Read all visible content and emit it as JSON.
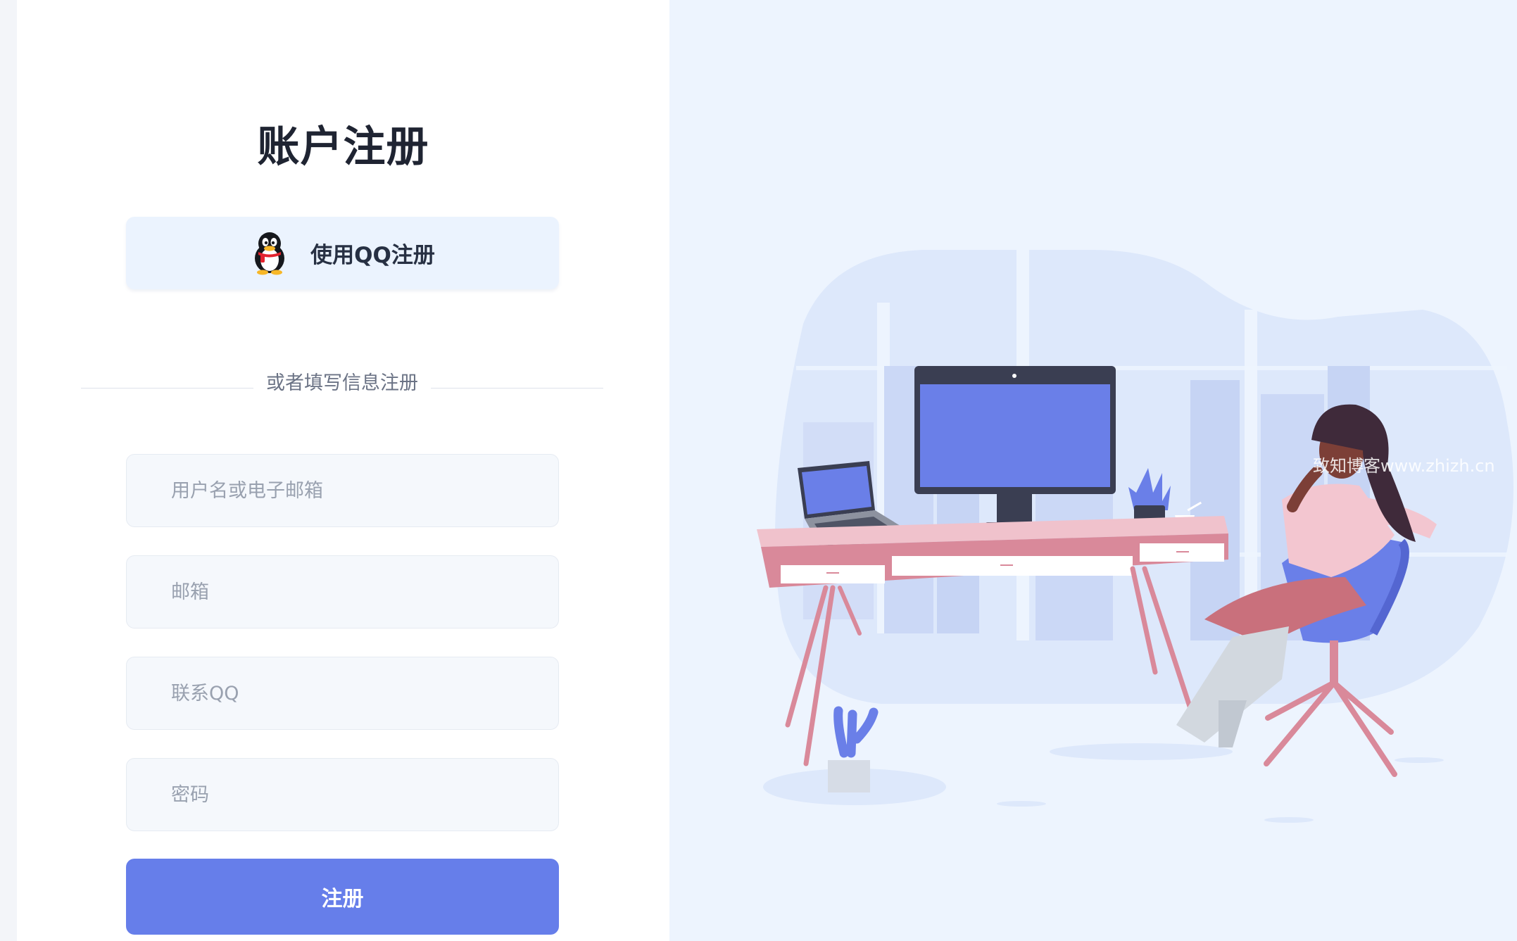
{
  "register": {
    "title": "账户注册",
    "qq_button_label": "使用QQ注册",
    "divider_text": "或者填写信息注册",
    "username_placeholder": "用户名或电子邮箱",
    "email_placeholder": "邮箱",
    "qq_placeholder": "联系QQ",
    "password_placeholder": "密码",
    "submit_label": "注册"
  },
  "illustration": {
    "watermark": "致知博客www.zhizh.cn"
  },
  "colors": {
    "accent": "#667eea",
    "right_panel_bg": "#edf4fe",
    "qq_button_bg": "#ebf3fe",
    "input_bg": "#f5f8fc",
    "title": "#1f2432"
  },
  "icons": {
    "qq": "qq-penguin-icon"
  }
}
